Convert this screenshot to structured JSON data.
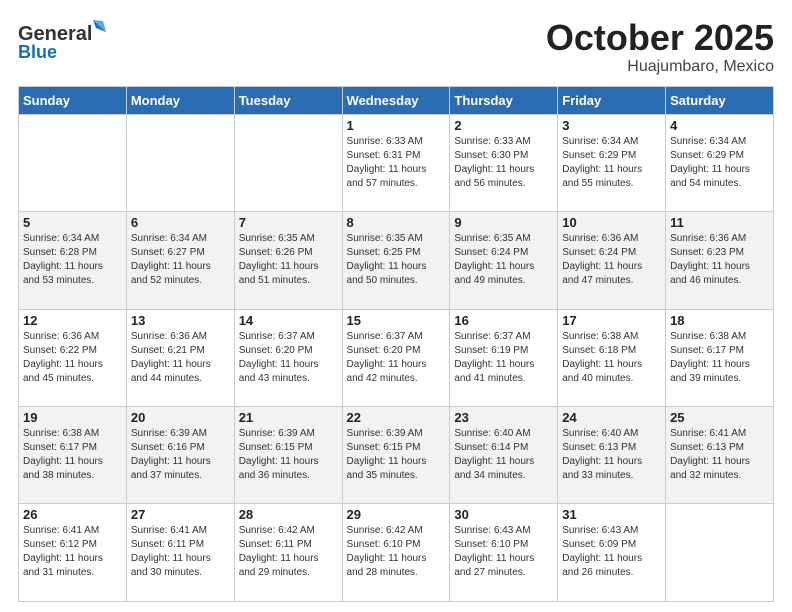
{
  "header": {
    "logo": {
      "general": "General",
      "blue": "Blue"
    },
    "title": "October 2025",
    "location": "Huajumbaro, Mexico"
  },
  "weekdays": [
    "Sunday",
    "Monday",
    "Tuesday",
    "Wednesday",
    "Thursday",
    "Friday",
    "Saturday"
  ],
  "weeks": [
    [
      {
        "day": "",
        "info": ""
      },
      {
        "day": "",
        "info": ""
      },
      {
        "day": "",
        "info": ""
      },
      {
        "day": "1",
        "sunrise": "6:33 AM",
        "sunset": "6:31 PM",
        "daylight": "11 hours and 57 minutes."
      },
      {
        "day": "2",
        "sunrise": "6:33 AM",
        "sunset": "6:30 PM",
        "daylight": "11 hours and 56 minutes."
      },
      {
        "day": "3",
        "sunrise": "6:34 AM",
        "sunset": "6:29 PM",
        "daylight": "11 hours and 55 minutes."
      },
      {
        "day": "4",
        "sunrise": "6:34 AM",
        "sunset": "6:29 PM",
        "daylight": "11 hours and 54 minutes."
      }
    ],
    [
      {
        "day": "5",
        "sunrise": "6:34 AM",
        "sunset": "6:28 PM",
        "daylight": "11 hours and 53 minutes."
      },
      {
        "day": "6",
        "sunrise": "6:34 AM",
        "sunset": "6:27 PM",
        "daylight": "11 hours and 52 minutes."
      },
      {
        "day": "7",
        "sunrise": "6:35 AM",
        "sunset": "6:26 PM",
        "daylight": "11 hours and 51 minutes."
      },
      {
        "day": "8",
        "sunrise": "6:35 AM",
        "sunset": "6:25 PM",
        "daylight": "11 hours and 50 minutes."
      },
      {
        "day": "9",
        "sunrise": "6:35 AM",
        "sunset": "6:24 PM",
        "daylight": "11 hours and 49 minutes."
      },
      {
        "day": "10",
        "sunrise": "6:36 AM",
        "sunset": "6:24 PM",
        "daylight": "11 hours and 47 minutes."
      },
      {
        "day": "11",
        "sunrise": "6:36 AM",
        "sunset": "6:23 PM",
        "daylight": "11 hours and 46 minutes."
      }
    ],
    [
      {
        "day": "12",
        "sunrise": "6:36 AM",
        "sunset": "6:22 PM",
        "daylight": "11 hours and 45 minutes."
      },
      {
        "day": "13",
        "sunrise": "6:36 AM",
        "sunset": "6:21 PM",
        "daylight": "11 hours and 44 minutes."
      },
      {
        "day": "14",
        "sunrise": "6:37 AM",
        "sunset": "6:20 PM",
        "daylight": "11 hours and 43 minutes."
      },
      {
        "day": "15",
        "sunrise": "6:37 AM",
        "sunset": "6:20 PM",
        "daylight": "11 hours and 42 minutes."
      },
      {
        "day": "16",
        "sunrise": "6:37 AM",
        "sunset": "6:19 PM",
        "daylight": "11 hours and 41 minutes."
      },
      {
        "day": "17",
        "sunrise": "6:38 AM",
        "sunset": "6:18 PM",
        "daylight": "11 hours and 40 minutes."
      },
      {
        "day": "18",
        "sunrise": "6:38 AM",
        "sunset": "6:17 PM",
        "daylight": "11 hours and 39 minutes."
      }
    ],
    [
      {
        "day": "19",
        "sunrise": "6:38 AM",
        "sunset": "6:17 PM",
        "daylight": "11 hours and 38 minutes."
      },
      {
        "day": "20",
        "sunrise": "6:39 AM",
        "sunset": "6:16 PM",
        "daylight": "11 hours and 37 minutes."
      },
      {
        "day": "21",
        "sunrise": "6:39 AM",
        "sunset": "6:15 PM",
        "daylight": "11 hours and 36 minutes."
      },
      {
        "day": "22",
        "sunrise": "6:39 AM",
        "sunset": "6:15 PM",
        "daylight": "11 hours and 35 minutes."
      },
      {
        "day": "23",
        "sunrise": "6:40 AM",
        "sunset": "6:14 PM",
        "daylight": "11 hours and 34 minutes."
      },
      {
        "day": "24",
        "sunrise": "6:40 AM",
        "sunset": "6:13 PM",
        "daylight": "11 hours and 33 minutes."
      },
      {
        "day": "25",
        "sunrise": "6:41 AM",
        "sunset": "6:13 PM",
        "daylight": "11 hours and 32 minutes."
      }
    ],
    [
      {
        "day": "26",
        "sunrise": "6:41 AM",
        "sunset": "6:12 PM",
        "daylight": "11 hours and 31 minutes."
      },
      {
        "day": "27",
        "sunrise": "6:41 AM",
        "sunset": "6:11 PM",
        "daylight": "11 hours and 30 minutes."
      },
      {
        "day": "28",
        "sunrise": "6:42 AM",
        "sunset": "6:11 PM",
        "daylight": "11 hours and 29 minutes."
      },
      {
        "day": "29",
        "sunrise": "6:42 AM",
        "sunset": "6:10 PM",
        "daylight": "11 hours and 28 minutes."
      },
      {
        "day": "30",
        "sunrise": "6:43 AM",
        "sunset": "6:10 PM",
        "daylight": "11 hours and 27 minutes."
      },
      {
        "day": "31",
        "sunrise": "6:43 AM",
        "sunset": "6:09 PM",
        "daylight": "11 hours and 26 minutes."
      },
      {
        "day": "",
        "info": ""
      }
    ]
  ],
  "labels": {
    "sunrise": "Sunrise:",
    "sunset": "Sunset:",
    "daylight": "Daylight:"
  }
}
